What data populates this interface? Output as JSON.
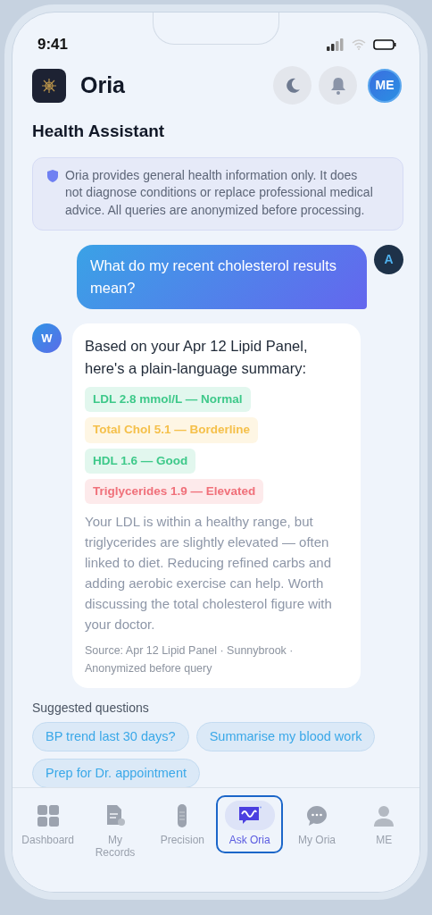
{
  "status_bar": {
    "time": "9:41"
  },
  "header": {
    "app_name": "Oria",
    "avatar_initials": "ME"
  },
  "title": "Health Assistant",
  "disclaimer": "Oria provides general health information only. It does not diagnose conditions or replace professional medical advice. All queries are anonymized before processing.",
  "messages": [
    {
      "kind": "user",
      "text": "What do my recent cholesterol results mean?",
      "avatar": "A"
    },
    {
      "kind": "assistant",
      "avatar": "W",
      "intro": "Based on your Apr 12 Lipid Panel, here's a plain-language summary:",
      "results": [
        {
          "text": "LDL 2.8 mmol/L — Normal",
          "color": "#3ec98a"
        },
        {
          "text": "Total Chol 5.1 — Borderline",
          "color": "#f5c04a"
        },
        {
          "text": "HDL 1.6 — Good",
          "color": "#3ec98a"
        },
        {
          "text": "Triglycerides 1.9 — Elevated",
          "color": "#f0707a"
        }
      ],
      "body": "Your LDL is within a healthy range, but triglycerides are slightly elevated — often linked to diet. Reducing refined carbs and adding aerobic exercise can help. Worth discussing the total cholesterol figure with your doctor.",
      "source": "Source: Apr 12 Lipid Panel · Sunnybrook · Anonymized before query"
    }
  ],
  "suggestions": {
    "label": "Suggested questions",
    "chips": [
      "BP trend last 30 days?",
      "Summarise my blood work",
      "Prep for Dr. appointment"
    ]
  },
  "nav": [
    {
      "label": "Dashboard",
      "selected": false
    },
    {
      "label": "My Records",
      "selected": false
    },
    {
      "label": "Precision",
      "selected": false
    },
    {
      "label": "Ask Oria",
      "selected": true
    },
    {
      "label": "My Oria",
      "selected": false
    },
    {
      "label": "ME",
      "selected": false
    }
  ]
}
